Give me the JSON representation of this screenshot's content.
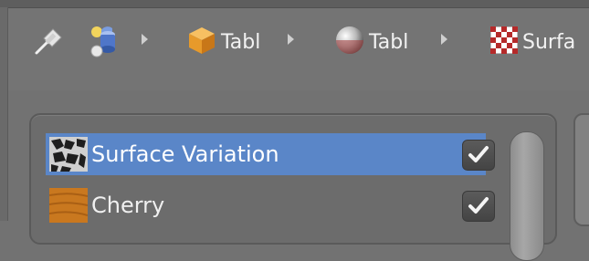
{
  "breadcrumb": {
    "items": [
      {
        "icon": "pin-icon"
      },
      {
        "icon": "scene-icon"
      },
      {
        "icon": "object-icon",
        "label": "Tabl"
      },
      {
        "icon": "material-icon",
        "label": "Tabl"
      },
      {
        "icon": "texture-icon",
        "label": "Surfa"
      }
    ]
  },
  "texture_list": {
    "items": [
      {
        "label": "Surface Variation",
        "selected": true,
        "checked": true,
        "thumb_icon": "noise-texture-thumbnail"
      },
      {
        "label": "Cherry",
        "selected": false,
        "checked": true,
        "thumb_icon": "cherry-wood-thumbnail"
      }
    ]
  },
  "colors": {
    "background": "#727272",
    "panel": "#6c6c6c",
    "selected_row": "#5a86c8",
    "text": "#ffffff"
  }
}
